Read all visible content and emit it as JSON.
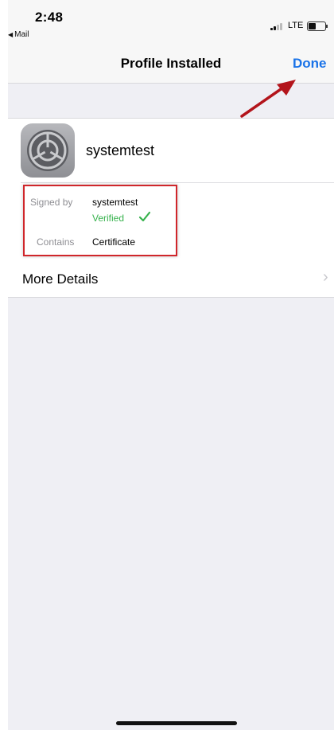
{
  "status_bar": {
    "time": "2:48",
    "back_app": "Mail",
    "network": "LTE"
  },
  "nav": {
    "title": "Profile Installed",
    "done_label": "Done"
  },
  "profile": {
    "name": "systemtest",
    "signed_by_label": "Signed by",
    "signed_by_value": "systemtest",
    "verified_label": "Verified",
    "contains_label": "Contains",
    "contains_value": "Certificate"
  },
  "more_details": {
    "label": "More Details"
  },
  "colors": {
    "accent": "#1a73e8",
    "verified": "#37b24d",
    "highlight": "#d0262b",
    "arrow": "#b3141b"
  }
}
